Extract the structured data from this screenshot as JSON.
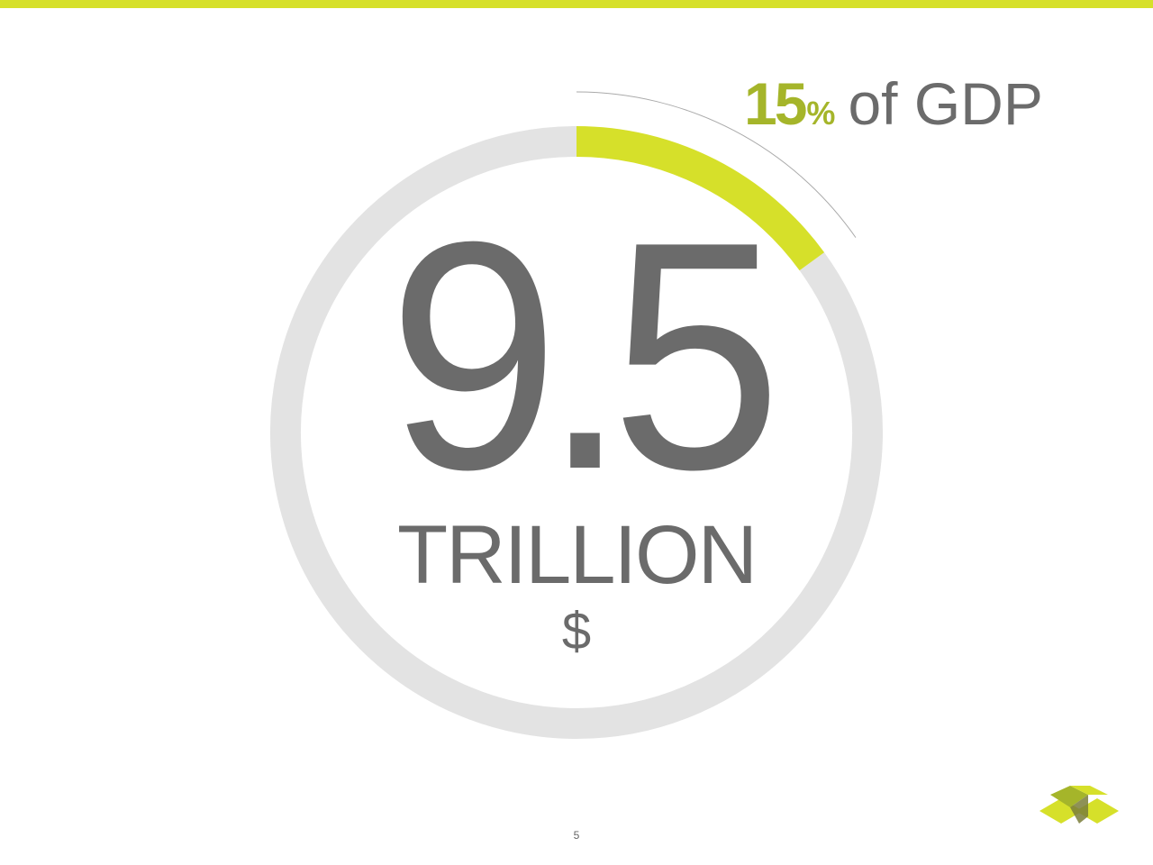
{
  "colors": {
    "accent": "#d6e02a",
    "accent_dark": "#a5b52a",
    "track": "#e3e3e3",
    "text": "#6b6b6b",
    "guide_line": "#aaaaaa"
  },
  "chart_data": {
    "type": "pie",
    "style": "donut",
    "values": [
      15,
      85
    ],
    "unit": "%",
    "center_value": "9.5",
    "center_unit": "TRILLION",
    "center_currency": "$"
  },
  "gdp_callout": {
    "value": "15",
    "unit": "%",
    "text": "of GDP"
  },
  "page_number": "5",
  "logo": {
    "icon": "folded-box-logo-icon"
  }
}
